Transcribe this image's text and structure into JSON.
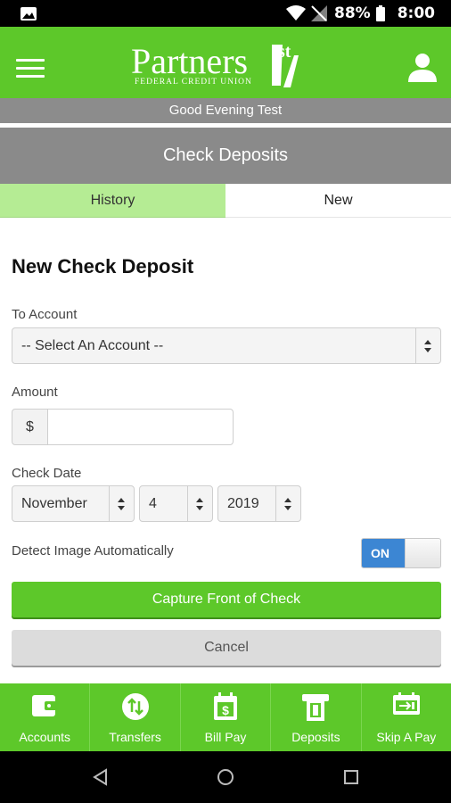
{
  "status_bar": {
    "battery": "88%",
    "time": "8:00"
  },
  "header": {
    "logo_text": "Partners",
    "logo_superscript": "1st",
    "logo_subtitle": "FEDERAL CREDIT UNION",
    "menu_icon": "hamburger-icon",
    "user_icon": "user-icon",
    "brand_color": "#5dc82a"
  },
  "greeting": "Good Evening Test",
  "page_title": "Check Deposits",
  "tabs": [
    {
      "label": "History",
      "active": false
    },
    {
      "label": "New",
      "active": true
    }
  ],
  "form": {
    "title": "New Check Deposit",
    "to_account_label": "To Account",
    "to_account_value": "-- Select An Account --",
    "amount_label": "Amount",
    "amount_prefix": "$",
    "amount_value": "",
    "check_date_label": "Check Date",
    "month": "November",
    "day": "4",
    "year": "2019",
    "detect_label": "Detect Image Automatically",
    "detect_state": "ON",
    "capture_button": "Capture Front of Check",
    "cancel_button": "Cancel"
  },
  "bottom_nav": [
    {
      "label": "Accounts",
      "icon": "wallet-icon"
    },
    {
      "label": "Transfers",
      "icon": "transfer-icon"
    },
    {
      "label": "Bill Pay",
      "icon": "calendar-dollar-icon"
    },
    {
      "label": "Deposits",
      "icon": "check-deposit-icon"
    },
    {
      "label": "Skip A Pay",
      "icon": "skip-pay-icon"
    }
  ],
  "system_nav": {
    "back_icon": "back-icon",
    "home_icon": "home-icon",
    "recents_icon": "recents-icon"
  }
}
